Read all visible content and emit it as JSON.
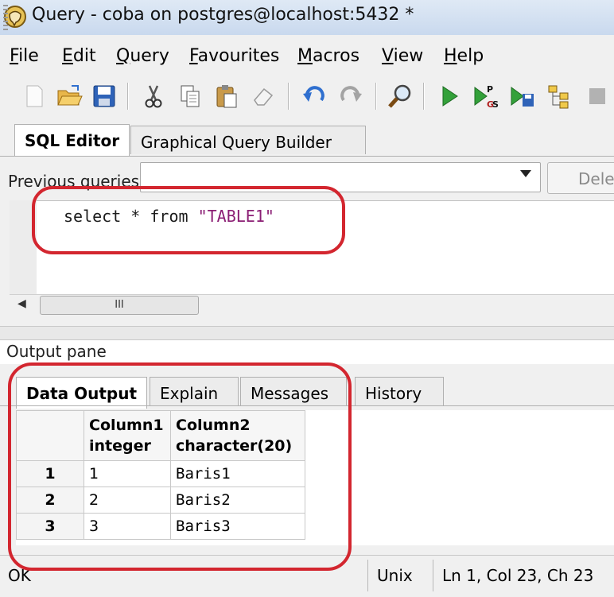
{
  "window": {
    "title": "Query - coba on postgres@localhost:5432 *"
  },
  "menu": [
    "File",
    "Edit",
    "Query",
    "Favourites",
    "Macros",
    "View",
    "Help"
  ],
  "toolbar": {
    "icons": [
      "new-file-icon",
      "open-folder-icon",
      "save-icon",
      "cut-icon",
      "copy-icon",
      "paste-icon",
      "clear-icon",
      "undo-icon",
      "redo-icon",
      "find-icon",
      "execute-icon",
      "execute-pgscript-icon",
      "execute-to-file-icon",
      "explain-icon",
      "stop-icon"
    ]
  },
  "editor": {
    "tabs": [
      "SQL Editor",
      "Graphical Query Builder"
    ],
    "previous_queries_label": "Previous queries",
    "delete_label": "Delete",
    "sql_keyword_part": "select * from ",
    "sql_string_part": "\"TABLE1\"",
    "scrollbar_thumb_label": "III"
  },
  "output": {
    "label": "Output pane",
    "tabs": [
      "Data Output",
      "Explain",
      "Messages",
      "History"
    ],
    "columns": [
      {
        "name": "Column1",
        "type": "integer"
      },
      {
        "name": "Column2",
        "type": "character(20)"
      }
    ],
    "rows": [
      {
        "num": "1",
        "c1": "1",
        "c2": "Baris1"
      },
      {
        "num": "2",
        "c1": "2",
        "c2": "Baris2"
      },
      {
        "num": "3",
        "c1": "3",
        "c2": "Baris3"
      }
    ]
  },
  "status": {
    "left": "OK",
    "line_ending": "Unix",
    "position": "Ln 1, Col 23, Ch 23"
  },
  "colors": {
    "annotation": "#d3262f",
    "sql_string": "#8b1e74"
  }
}
